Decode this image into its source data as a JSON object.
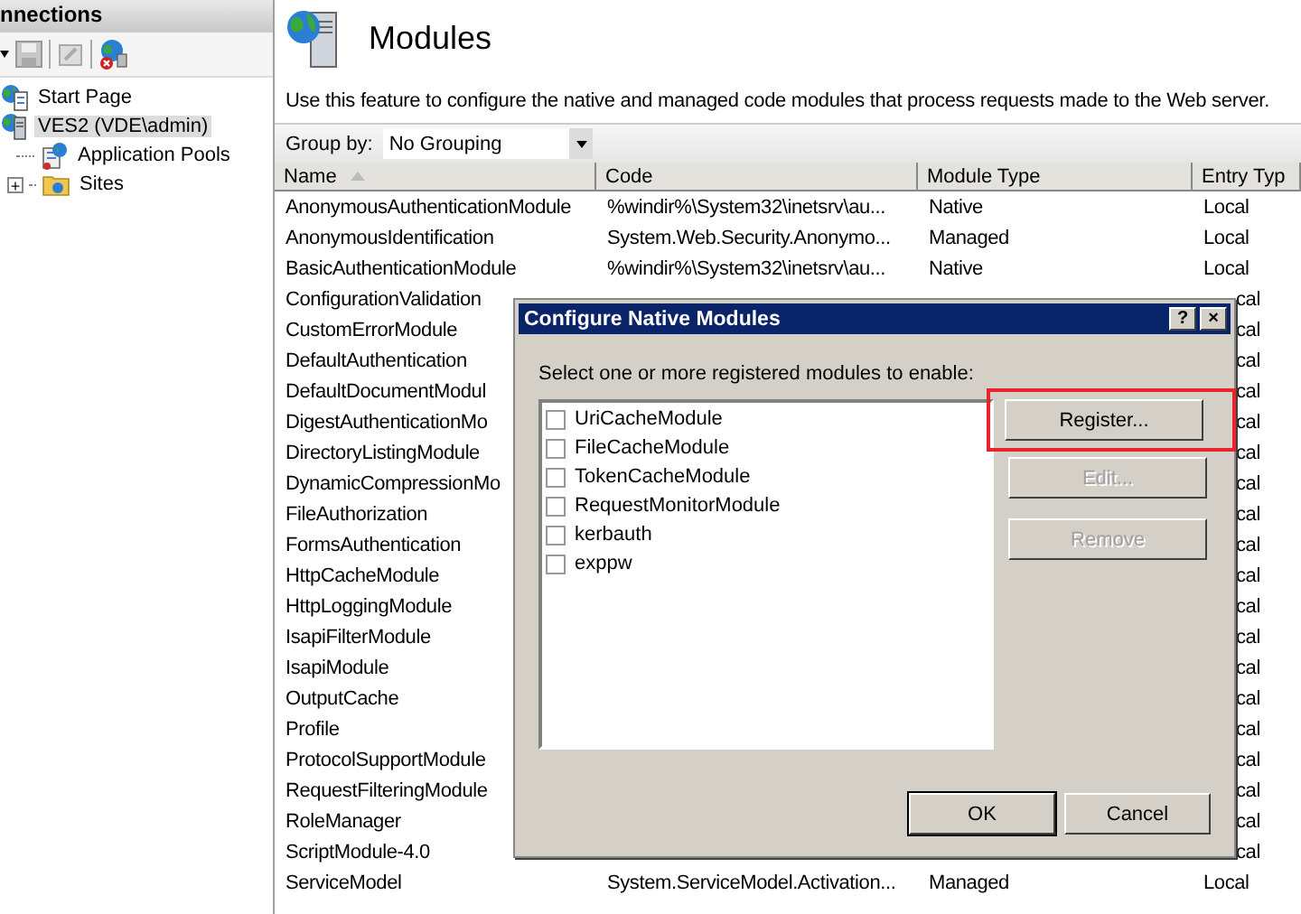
{
  "connections": {
    "title": "nnections",
    "tree": [
      {
        "label": "Start Page",
        "kind": "page",
        "selected": false
      },
      {
        "label": "VES2 (VDE\\admin)",
        "kind": "server",
        "selected": true,
        "children": [
          {
            "label": "Application Pools",
            "kind": "pools",
            "selected": false
          },
          {
            "label": "Sites",
            "kind": "sites",
            "selected": false,
            "expanded": false,
            "toggle": "+"
          }
        ]
      }
    ]
  },
  "page": {
    "title": "Modules",
    "description": "Use this feature to configure the native and managed code modules that process requests made to the Web server.",
    "group_by": {
      "label": "Group by:",
      "value": "No Grouping"
    }
  },
  "table": {
    "columns": [
      {
        "label": "Name",
        "sorted": true
      },
      {
        "label": "Code",
        "sorted": false
      },
      {
        "label": "Module Type",
        "sorted": false
      },
      {
        "label": "Entry Typ",
        "sorted": false
      }
    ],
    "rows": [
      {
        "name": "AnonymousAuthenticationModule",
        "code": "%windir%\\System32\\inetsrv\\au...",
        "type": "Native",
        "entry": "Local"
      },
      {
        "name": "AnonymousIdentification",
        "code": "System.Web.Security.Anonymo...",
        "type": "Managed",
        "entry": "Local"
      },
      {
        "name": "BasicAuthenticationModule",
        "code": "%windir%\\System32\\inetsrv\\au...",
        "type": "Native",
        "entry": "Local"
      },
      {
        "name": "ConfigurationValidation",
        "entry": "cal"
      },
      {
        "name": "CustomErrorModule",
        "entry": "cal"
      },
      {
        "name": "DefaultAuthentication",
        "entry": "cal"
      },
      {
        "name": "DefaultDocumentModul",
        "entry": "cal"
      },
      {
        "name": "DigestAuthenticationMo",
        "entry": "cal"
      },
      {
        "name": "DirectoryListingModule",
        "entry": "cal"
      },
      {
        "name": "DynamicCompressionMo",
        "entry": "cal"
      },
      {
        "name": "FileAuthorization",
        "entry": "cal"
      },
      {
        "name": "FormsAuthentication",
        "entry": "cal"
      },
      {
        "name": "HttpCacheModule",
        "entry": "cal"
      },
      {
        "name": "HttpLoggingModule",
        "entry": "cal"
      },
      {
        "name": "IsapiFilterModule",
        "entry": "cal"
      },
      {
        "name": "IsapiModule",
        "entry": "cal"
      },
      {
        "name": "OutputCache",
        "entry": "cal"
      },
      {
        "name": "Profile",
        "entry": "cal"
      },
      {
        "name": "ProtocolSupportModule",
        "entry": "cal"
      },
      {
        "name": "RequestFilteringModule",
        "entry": "cal"
      },
      {
        "name": "RoleManager",
        "entry": "cal"
      },
      {
        "name": "ScriptModule-4.0",
        "entry": "cal"
      },
      {
        "name": "ServiceModel",
        "code": "System.ServiceModel.Activation...",
        "type": "Managed",
        "entry": "Local"
      }
    ]
  },
  "dialog": {
    "title": "Configure Native Modules",
    "help": "?",
    "close": "×",
    "prompt": "Select one or more registered modules to enable:",
    "modules": [
      {
        "label": "UriCacheModule",
        "checked": false
      },
      {
        "label": "FileCacheModule",
        "checked": false
      },
      {
        "label": "TokenCacheModule",
        "checked": false
      },
      {
        "label": "RequestMonitorModule",
        "checked": false
      },
      {
        "label": "kerbauth",
        "checked": false
      },
      {
        "label": "exppw",
        "checked": false
      }
    ],
    "side_buttons": [
      {
        "label": "Register...",
        "disabled": false,
        "highlighted": true
      },
      {
        "label": "Edit...",
        "disabled": true,
        "highlighted": false
      },
      {
        "label": "Remove",
        "disabled": true,
        "highlighted": false
      }
    ],
    "buttons": [
      {
        "label": "OK",
        "default": true
      },
      {
        "label": "Cancel",
        "default": false
      }
    ]
  }
}
